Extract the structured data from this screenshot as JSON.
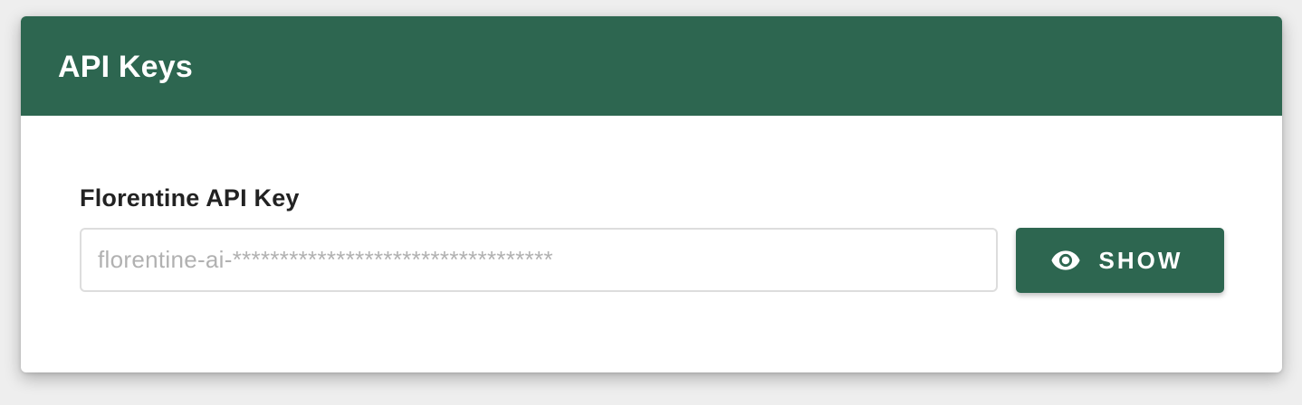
{
  "theme": {
    "accent": "#2d6650"
  },
  "card": {
    "title": "API Keys"
  },
  "api_key_field": {
    "label": "Florentine API Key",
    "value": "florentine-ai-**********************************"
  },
  "show_button": {
    "label": "SHOW",
    "icon": "eye-icon"
  }
}
